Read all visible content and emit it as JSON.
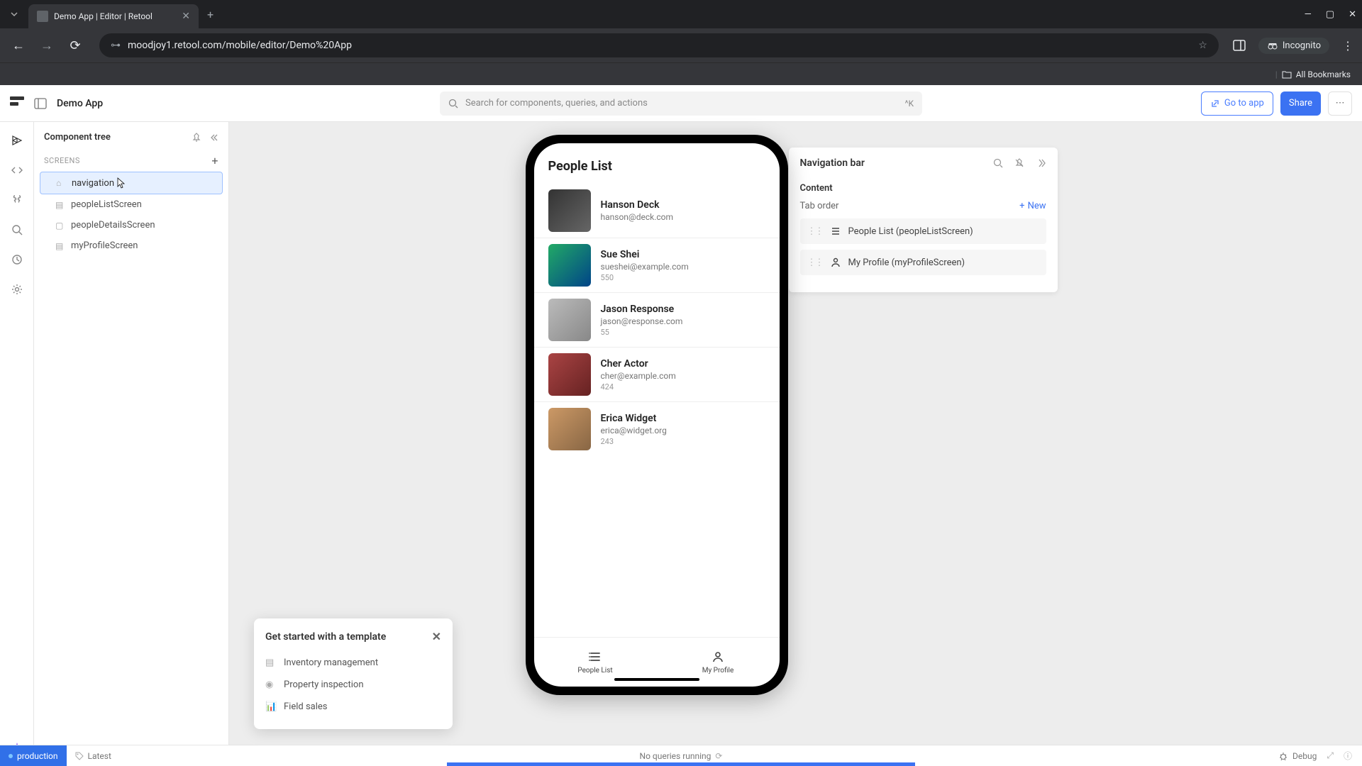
{
  "browser": {
    "tab_title": "Demo App | Editor | Retool",
    "url": "moodjoy1.retool.com/mobile/editor/Demo%20App",
    "incognito_label": "Incognito",
    "all_bookmarks": "All Bookmarks"
  },
  "header": {
    "app_title": "Demo App",
    "search_placeholder": "Search for components, queries, and actions",
    "search_shortcut": "^K",
    "go_to_app": "Go to app",
    "share": "Share"
  },
  "sidebar": {
    "title": "Component tree",
    "section_label": "SCREENS",
    "items": [
      {
        "label": "navigation",
        "selected": true,
        "has_cursor": true
      },
      {
        "label": "peopleListScreen",
        "selected": false
      },
      {
        "label": "peopleDetailsScreen",
        "selected": false
      },
      {
        "label": "myProfileScreen",
        "selected": false
      }
    ]
  },
  "phone": {
    "screen_title": "People List",
    "people": [
      {
        "name": "Hanson Deck",
        "email": "hanson@deck.com",
        "num": ""
      },
      {
        "name": "Sue Shei",
        "email": "sueshei@example.com",
        "num": "550"
      },
      {
        "name": "Jason Response",
        "email": "jason@response.com",
        "num": "55"
      },
      {
        "name": "Cher Actor",
        "email": "cher@example.com",
        "num": "424"
      },
      {
        "name": "Erica Widget",
        "email": "erica@widget.org",
        "num": "243"
      }
    ],
    "tabs": [
      {
        "label": "People List",
        "icon": "list"
      },
      {
        "label": "My Profile",
        "icon": "person"
      }
    ]
  },
  "inspector": {
    "title": "Navigation bar",
    "content_label": "Content",
    "tab_order_label": "Tab order",
    "new_label": "New",
    "items": [
      {
        "label": "People List (peopleListScreen)",
        "icon": "list"
      },
      {
        "label": "My Profile (myProfileScreen)",
        "icon": "person"
      }
    ]
  },
  "template_popup": {
    "title": "Get started with a template",
    "items": [
      "Inventory management",
      "Property inspection",
      "Field sales"
    ]
  },
  "footer": {
    "env": "production",
    "latest": "Latest",
    "queries_status": "No queries running",
    "debug": "Debug"
  }
}
